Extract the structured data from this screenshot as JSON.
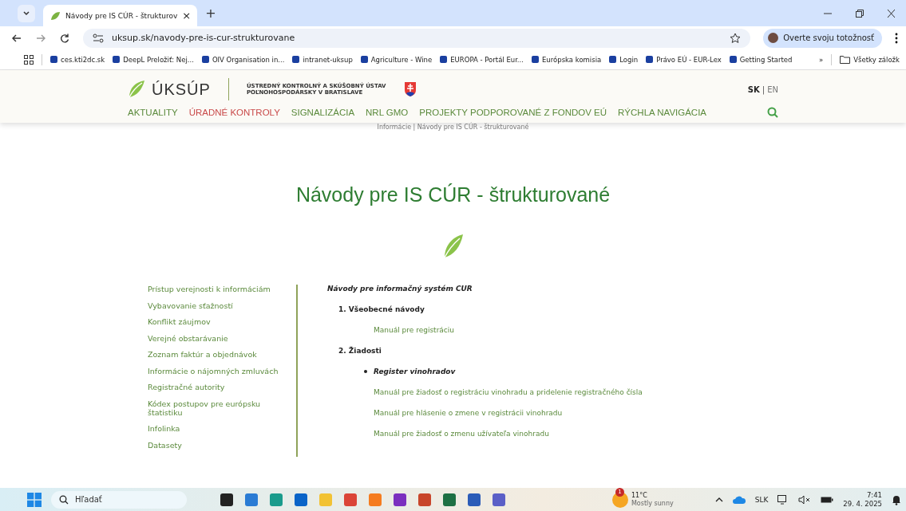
{
  "browser": {
    "tabs": [
      {
        "title": "Návody pre IS CÚR - štrukturov",
        "close": "×",
        "selected": true
      }
    ],
    "new_tab": "+",
    "address": "uksup.sk/navody-pre-is-cur-strukturovane",
    "profile": "Overte svoju totožnosť",
    "bookmarks": [
      {
        "label": "ces.kti2dc.sk"
      },
      {
        "label": "DeepL Preložiť: Nej..."
      },
      {
        "label": "OIV Organisation in..."
      },
      {
        "label": "intranet-uksup"
      },
      {
        "label": "Agriculture - Wine"
      },
      {
        "label": "EUROPA - Portál Eur..."
      },
      {
        "label": "Európska komisia"
      },
      {
        "label": "Login"
      },
      {
        "label": "Právo EÚ - EUR-Lex"
      },
      {
        "label": "Getting Started"
      }
    ],
    "more_bookmarks": "»",
    "all_bookmarks": "Všetky záložk"
  },
  "site": {
    "logo": "ÚKSÚP",
    "org_line_1": "ÚSTREDNÝ KONTROLNÝ A SKÚŠOBNÝ ÚSTAV",
    "org_line_2": "POĽNOHOSPODÁRSKY V BRATISLAVE",
    "languages": [
      {
        "label": "SK",
        "selected": true
      },
      {
        "label": "EN",
        "selected": false
      }
    ],
    "lang_separator": "|",
    "nav": [
      {
        "label": "AKTUALITY",
        "selected": false
      },
      {
        "label": "ÚRADNÉ KONTROLY",
        "selected": true
      },
      {
        "label": "SIGNALIZÁCIA",
        "selected": false
      },
      {
        "label": "NRL GMO",
        "selected": false
      },
      {
        "label": "PROJEKTY PODPOROVANÉ Z FONDOV EÚ",
        "selected": false
      },
      {
        "label": "RÝCHLA NAVIGÁCIA",
        "selected": false
      }
    ],
    "breadcrumb": "Informácie | Návody pre IS CÚR - štrukturované",
    "title": "Návody pre IS CÚR - štrukturované",
    "sidebar": [
      {
        "label": "Prístup verejnosti k informáciám"
      },
      {
        "label": "Vybavovanie sťažností"
      },
      {
        "label": "Konflikt záujmov"
      },
      {
        "label": "Verejné obstarávanie"
      },
      {
        "label": "Zoznam faktúr a objednávok"
      },
      {
        "label": "Informácie o nájomných zmluvách"
      },
      {
        "label": "Registračné autority"
      },
      {
        "label": "Kódex postupov pre európsku štatistiku"
      },
      {
        "label": "Infolinka"
      },
      {
        "label": "Datasety"
      }
    ],
    "content": [
      {
        "kind": "heading",
        "text": "Návody pre informačný systém CUR"
      },
      {
        "kind": "section",
        "text": "1. Všeobecné návody"
      },
      {
        "kind": "link",
        "text": "Manuál pre registráciu"
      },
      {
        "kind": "section",
        "text": "2. Žiadosti"
      },
      {
        "kind": "bullet",
        "text": "Register vinohradov"
      },
      {
        "kind": "link",
        "text": "Manuál pre žiadosť o registráciu vinohradu a pridelenie registračného čísla"
      },
      {
        "kind": "link",
        "text": "Manuál pre hlásenie o zmene v registrácii vinohradu"
      },
      {
        "kind": "link",
        "text": "Manuál pre žiadosť o zmenu užívateľa vinohradu"
      }
    ]
  },
  "taskbar": {
    "search": "Hľadať",
    "weather_badge": "1",
    "temperature": "11°C",
    "weather": "Mostly sunny",
    "language": "SLK",
    "time": "7:41",
    "date": "29. 4. 2025"
  }
}
